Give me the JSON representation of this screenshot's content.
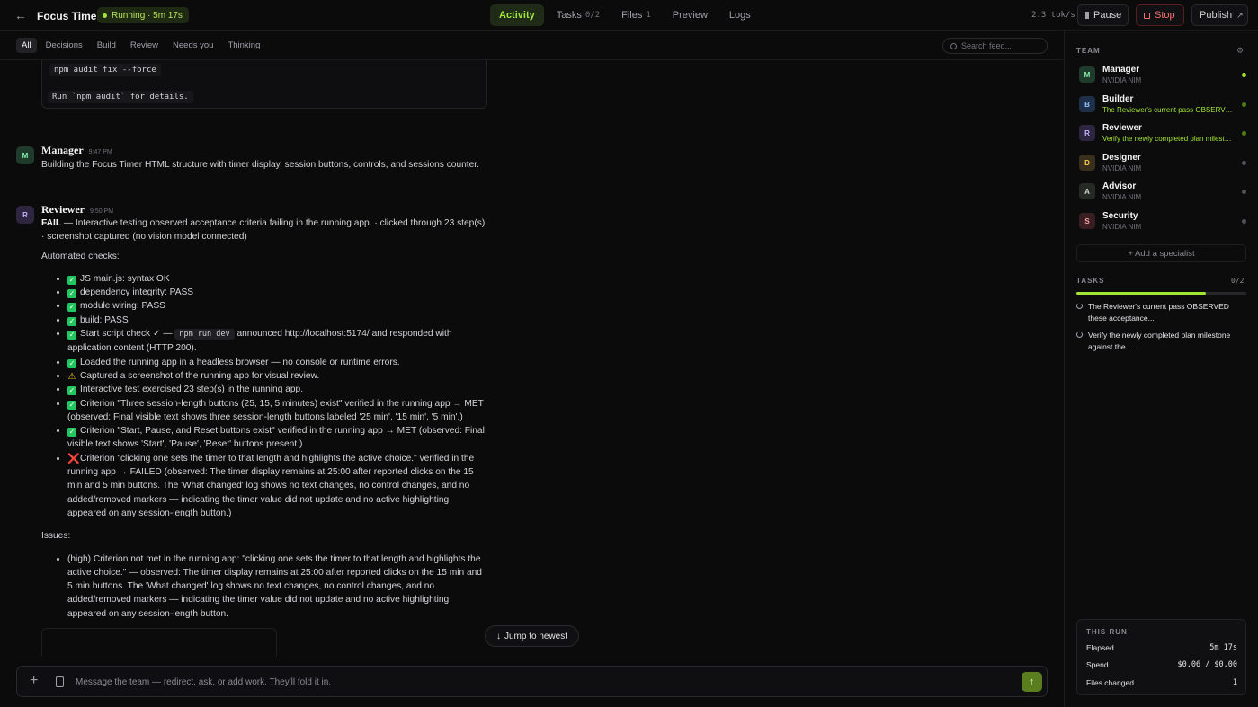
{
  "header": {
    "back_icon": "arrow-left-icon",
    "title": "Focus Timer",
    "status_badge": "Running · 5m 17s",
    "nav": [
      {
        "label": "Activity",
        "count": ""
      },
      {
        "label": "Tasks",
        "count": "0/2"
      },
      {
        "label": "Files",
        "count": "1"
      },
      {
        "label": "Preview",
        "count": ""
      },
      {
        "label": "Logs",
        "count": ""
      }
    ],
    "rate": "2.3 tok/s",
    "pause_label": "Pause",
    "stop_label": "Stop",
    "publish_label": "Publish",
    "stop_color": "#f87171",
    "accent_color": "#a3e635"
  },
  "filters": [
    "All",
    "Decisions",
    "Build",
    "Review",
    "Needs you",
    "Thinking"
  ],
  "search": {
    "placeholder": "Search feed..."
  },
  "feed": {
    "prev_card": {
      "code_line": "npm audit fix --force",
      "footer_line": "Run `npm audit` for details."
    },
    "manager_msg": {
      "avatar": "M",
      "author": "Manager",
      "time": "9:47 PM",
      "text": "Building the Focus Timer HTML structure with timer display, session buttons, controls, and sessions counter."
    },
    "reviewer_msg": {
      "avatar": "R",
      "author": "Reviewer",
      "time": "9:50 PM",
      "verdict": "FAIL",
      "verdict_rest": " — Interactive testing observed acceptance criteria failing in the running app. · clicked through 23 step(s) · screenshot captured (no vision model connected)",
      "checks_heading": "Automated checks:",
      "checks": [
        {
          "mark": "ok",
          "text": "JS main.js: syntax OK"
        },
        {
          "mark": "ok",
          "text": "dependency integrity: PASS"
        },
        {
          "mark": "ok",
          "text": "module wiring: PASS"
        },
        {
          "mark": "ok",
          "text": "build: PASS"
        },
        {
          "mark": "ok",
          "text": ""
        },
        {
          "mark": "ok",
          "text": "Loaded the running app in a headless browser — no console or runtime errors."
        },
        {
          "mark": "warn",
          "text": "Captured a screenshot of the running app for visual review."
        },
        {
          "mark": "ok",
          "text": "Interactive test exercised 23 step(s) in the running app."
        },
        {
          "mark": "ok",
          "text": "Criterion \"Three session-length buttons (25, 15, 5 minutes) exist\" verified in the running app → MET (observed: Final visible text shows three session-length buttons labeled '25 min', '15 min', '5 min'.)"
        },
        {
          "mark": "ok",
          "text": "Criterion \"Start, Pause, and Reset buttons exist\" verified in the running app → MET (observed: Final visible text shows 'Start', 'Pause', 'Reset' buttons present.)"
        },
        {
          "mark": "fail",
          "text": "Criterion \"clicking one sets the timer to that length and highlights the active choice.\" verified in the running app → FAILED (observed: The timer display remains at 25:00 after reported clicks on the 15 min and 5 min buttons. The 'What changed' log shows no text changes, no control changes, and no added/removed markers — indicating the timer value did not update and no active highlighting appeared on any session-length button.)"
        }
      ],
      "start_check_pre": "Start script check ✓ — ",
      "start_check_code": "npm run dev",
      "start_check_post": " announced http://localhost:5174/ and responded with application content (HTTP 200).",
      "issues_heading": "Issues:",
      "issues": [
        "(high) Criterion not met in the running app: \"clicking one sets the timer to that length and highlights the active choice.\" — observed: The timer display remains at 25:00 after reported clicks on the 15 min and 5 min buttons. The 'What changed' log shows no text changes, no control changes, and no added/removed markers — indicating the timer value did not update and no active highlighting appeared on any session-length button."
      ]
    }
  },
  "jump_label": "Jump to newest",
  "composer": {
    "placeholder": "Message the team — redirect, ask, or add work. They'll fold it in."
  },
  "team": {
    "heading": "TEAM",
    "members": [
      {
        "initial": "M",
        "name": "Manager",
        "sub": "NVIDIA NIM",
        "active": false,
        "status": "on",
        "color": "#1f3b2b",
        "text_color": "#86efac"
      },
      {
        "initial": "B",
        "name": "Builder",
        "sub": "The Reviewer's current pass OBSERVED these acceptance...",
        "active": true,
        "status": "mid",
        "color": "#1e2f4a",
        "text_color": "#93c5fd"
      },
      {
        "initial": "R",
        "name": "Reviewer",
        "sub": "Verify the newly completed plan milestone against the...",
        "active": true,
        "status": "mid",
        "color": "#2e2540",
        "text_color": "#c4b5fd"
      },
      {
        "initial": "D",
        "name": "Designer",
        "sub": "NVIDIA NIM",
        "active": false,
        "status": "off",
        "color": "#3a2e1c",
        "text_color": "#fcd34d"
      },
      {
        "initial": "A",
        "name": "Advisor",
        "sub": "NVIDIA NIM",
        "active": false,
        "status": "off",
        "color": "#262a26",
        "text_color": "#d4d4d8"
      },
      {
        "initial": "S",
        "name": "Security",
        "sub": "NVIDIA NIM",
        "active": false,
        "status": "off",
        "color": "#3a1f22",
        "text_color": "#fca5a5"
      }
    ],
    "add_label": "+ Add a specialist"
  },
  "tasks": {
    "heading": "TASKS",
    "count": "0/2",
    "progress": 0.76,
    "items": [
      "The Reviewer's current pass OBSERVED these acceptance...",
      "Verify the newly completed plan milestone against the..."
    ]
  },
  "run": {
    "heading": "THIS RUN",
    "rows": [
      {
        "label": "Elapsed",
        "value": "5m 17s"
      },
      {
        "label": "Spend",
        "value": "$0.06 / $0.00"
      },
      {
        "label": "Files changed",
        "value": "1"
      }
    ]
  }
}
